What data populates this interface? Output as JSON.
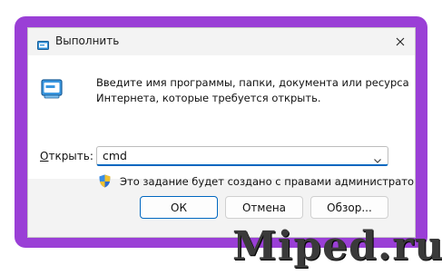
{
  "window": {
    "title": "Выполнить",
    "close_glyph": "✕",
    "accent_color": "#9a3fd6"
  },
  "main": {
    "description_line1": "Введите имя программы, папки, документа или ресурса",
    "description_line2": "Интернета, которые требуется открыть.",
    "open_label_underlined": "О",
    "open_label_rest": "ткрыть:",
    "combo_value": "cmd",
    "admin_note": "Это задание будет создано с правами администратора"
  },
  "buttons": {
    "ok": "ОК",
    "cancel": "Отмена",
    "browse": "Обзор..."
  },
  "watermark": {
    "text": "Miped.ru"
  },
  "icons": {
    "title": "run-icon",
    "main": "run-icon",
    "shield": "uac-shield-icon",
    "close": "close-icon",
    "dropdown": "chevron-down-icon"
  }
}
